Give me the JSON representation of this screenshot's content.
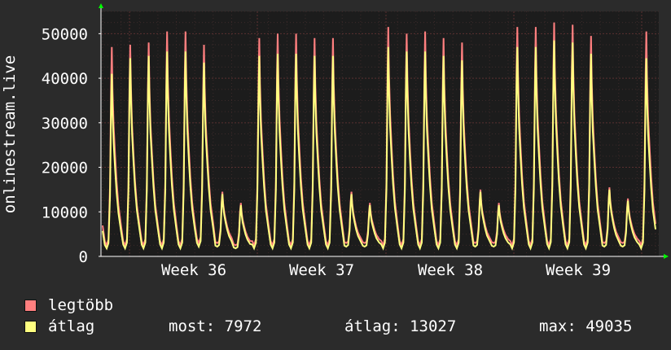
{
  "chart_data": {
    "type": "line",
    "ylabel": "onlinestream.live",
    "ylim": [
      0,
      55000
    ],
    "yticks": [
      0,
      10000,
      20000,
      30000,
      40000,
      50000
    ],
    "x_labels": [
      "Week 36",
      "Week 37",
      "Week 38",
      "Week 39"
    ],
    "grid": true,
    "series": [
      {
        "name": "legtöbb",
        "color": "#ff7f7f",
        "daily_peaks": [
          47000,
          47500,
          48000,
          50500,
          50500,
          47500,
          14500,
          12000,
          49000,
          50000,
          50000,
          49000,
          49000,
          14500,
          12000,
          51500,
          50000,
          50500,
          49000,
          48000,
          15000,
          12000,
          51500,
          51500,
          52500,
          52000,
          49500,
          15500,
          13000,
          50500
        ],
        "daily_troughs": [
          2500,
          2500,
          2500,
          2500,
          2500,
          3000,
          3000,
          2500,
          2500,
          2500,
          2500,
          2500,
          2500,
          3000,
          3000,
          2500,
          2500,
          2500,
          2500,
          2500,
          3000,
          3000,
          2500,
          2500,
          2500,
          2500,
          2500,
          3000,
          3000,
          2500
        ]
      },
      {
        "name": "átlag",
        "color": "#ffff80",
        "daily_peaks": [
          41000,
          44500,
          45000,
          46000,
          46000,
          43500,
          14000,
          11500,
          45000,
          45500,
          45500,
          45000,
          45000,
          14000,
          11500,
          47000,
          46000,
          46000,
          45000,
          44000,
          14500,
          11500,
          47000,
          47000,
          48500,
          48000,
          45500,
          15000,
          12500,
          44500
        ],
        "daily_troughs": [
          1800,
          1800,
          1800,
          1800,
          1800,
          2200,
          2200,
          1800,
          1800,
          1800,
          1800,
          1800,
          1800,
          2200,
          2200,
          1800,
          1800,
          1800,
          1800,
          1800,
          2200,
          2200,
          1800,
          1800,
          1800,
          1800,
          1800,
          2200,
          2200,
          1800
        ]
      }
    ]
  },
  "legend": {
    "max_label": "legtöbb",
    "avg_label": "átlag",
    "current": "most: 7972",
    "average": "átlag: 13027",
    "maximum": "max: 49035"
  },
  "colors": {
    "background": "#2b2b2b",
    "plot": "#1c1c1c",
    "grid_major": "#5a3030",
    "grid_minor": "#3c2a2a",
    "axis": "#ffffff",
    "arrow": "#00ff00"
  }
}
